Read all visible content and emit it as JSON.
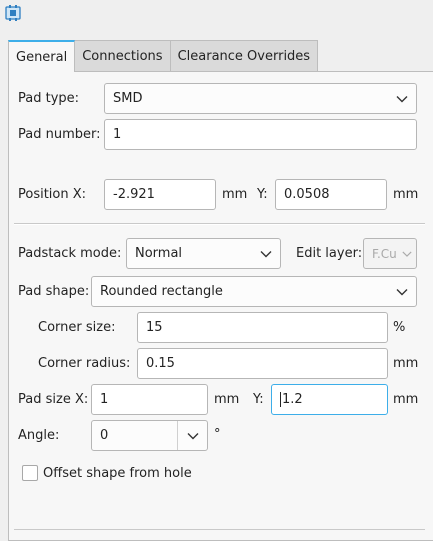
{
  "tabs": [
    {
      "label": "General"
    },
    {
      "label": "Connections"
    },
    {
      "label": "Clearance Overrides"
    }
  ],
  "pad_type": {
    "label": "Pad type:",
    "value": "SMD"
  },
  "pad_number": {
    "label": "Pad number:",
    "value": "1"
  },
  "position": {
    "x_label": "Position X:",
    "x_value": "-2.921",
    "x_unit": "mm",
    "y_label": "Y:",
    "y_value": "0.0508",
    "y_unit": "mm"
  },
  "padstack": {
    "mode_label": "Padstack mode:",
    "mode_value": "Normal",
    "edit_layer_label": "Edit layer:",
    "edit_layer_value": "F.Cu"
  },
  "pad_shape": {
    "label": "Pad shape:",
    "value": "Rounded rectangle"
  },
  "corner_size": {
    "label": "Corner size:",
    "value": "15",
    "unit": "%"
  },
  "corner_radius": {
    "label": "Corner radius:",
    "value": "0.15",
    "unit": "mm"
  },
  "pad_size": {
    "x_label": "Pad size X:",
    "x_value": "1",
    "x_unit": "mm",
    "y_label": "Y:",
    "y_value": "1.2",
    "y_unit": "mm"
  },
  "angle": {
    "label": "Angle:",
    "value": "0",
    "unit": "°"
  },
  "offset_checkbox": {
    "label": "Offset shape from hole",
    "checked": false
  },
  "colors": {
    "accent": "#3daee9",
    "background": "#efefef",
    "panel": "#f7f7f7"
  },
  "icons": [
    "app-icon",
    "chevron-down-icon"
  ]
}
